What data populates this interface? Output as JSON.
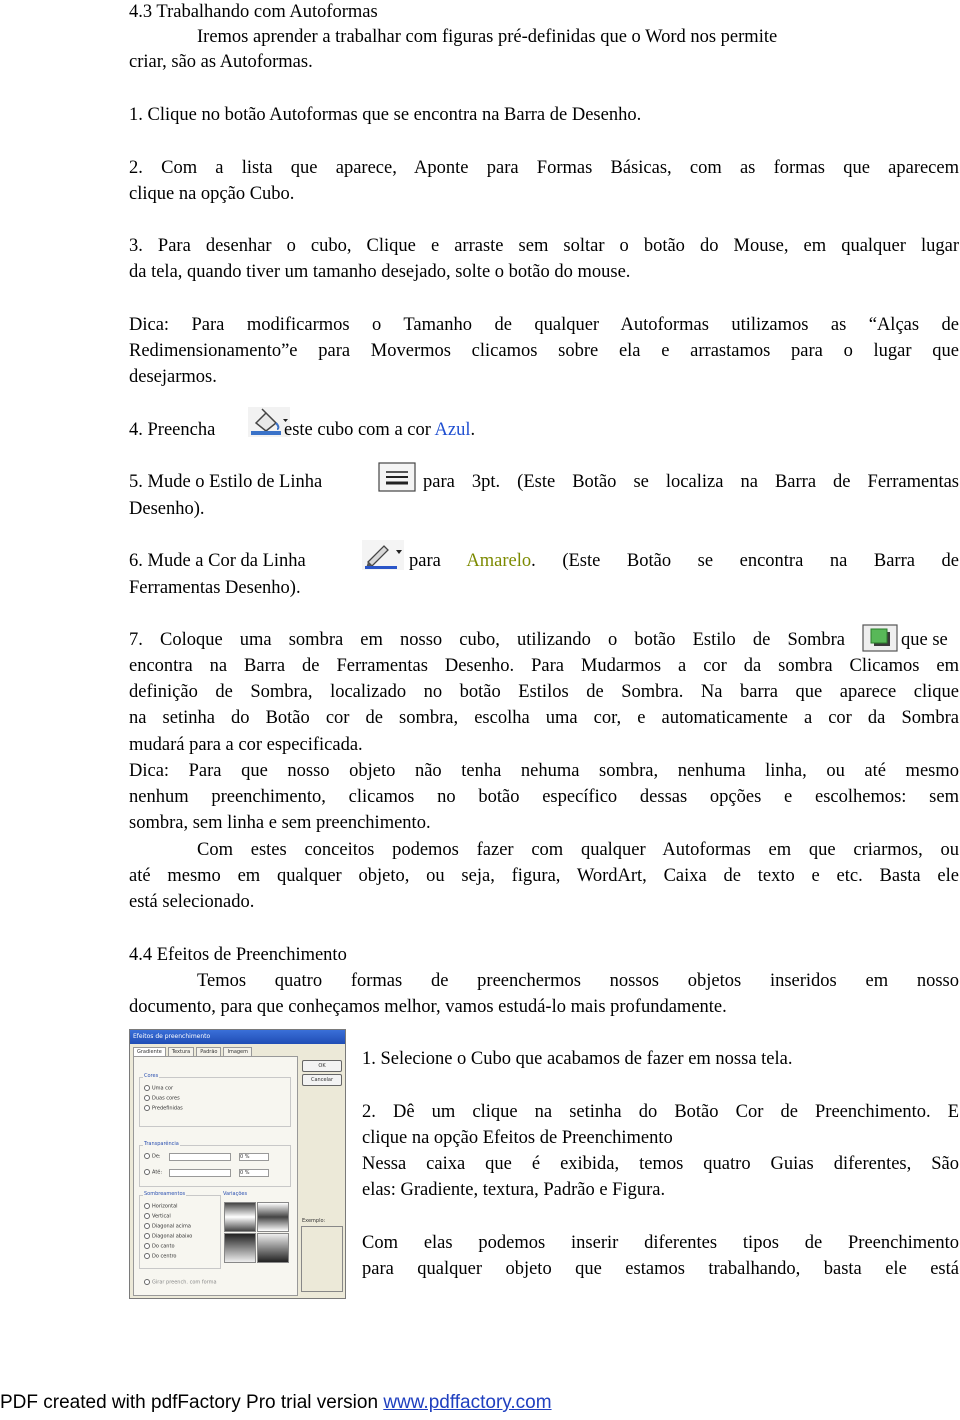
{
  "section1": {
    "heading": "4.3 Trabalhando com Autoformas",
    "intro_line1": "Iremos aprender a trabalhar com figuras pré-definidas que o Word nos permite",
    "intro_line2": "criar, são as Autoformas.",
    "step1": "1. Clique no botão Autoformas que se encontra na Barra de Desenho.",
    "step2_line1": "2. Com a lista que aparece, Aponte para Formas Básicas, com as formas que aparecem",
    "step2_line2": "clique na opção Cubo.",
    "step3_line1": "3. Para desenhar o cubo, Clique e arraste sem soltar o botão do Mouse, em qualquer lugar",
    "step3_line2": "da tela, quando tiver um tamanho desejado, solte o botão do mouse.",
    "tip_line1": "Dica: Para modificarmos o Tamanho de qualquer Autoformas utilizamos as “Alças de",
    "tip_line2": "Redimensionamento”e para Movermos clicamos sobre ela e arrastamos para o lugar que",
    "tip_line3": "desejarmos.",
    "step4_a": "4. Preencha",
    "step4_b": "este cubo com a cor",
    "step4_color": "Azul",
    "step4_end": ".",
    "step5_a": "5. Mude o Estilo de Linha",
    "step5_b": "para 3pt.  (Este Botão se localiza na Barra de Ferramentas",
    "step5_line2": "Desenho).",
    "step6_a": "6. Mude a Cor da Linha",
    "step6_b": "para",
    "step6_color": "Amarelo",
    "step6_c": ". (Este Botão se encontra na Barra de",
    "step6_line2": "Ferramentas Desenho).",
    "step7_line1_a": "7. Coloque uma sombra em nosso cubo, utilizando o botão Estilo de Sombra",
    "step7_line1_b": "que se",
    "step7_line2": "encontra na Barra de Ferramentas Desenho. Para Mudarmos a cor da sombra Clicamos em",
    "step7_line3": "definição de Sombra, localizado no botão Estilos de Sombra. Na barra que aparece clique",
    "step7_line4": "na setinha do Botão cor de sombra, escolha uma cor, e automaticamente a cor da Sombra",
    "step7_line5": "mudará para a cor especificada.",
    "tip2_line1": "Dica: Para que nosso objeto não tenha nehuma sombra, nenhuma linha, ou até mesmo",
    "tip2_line2": "nenhum preenchimento, clicamos no botão específico dessas opções e escolhemos: sem",
    "tip2_line3": "sombra, sem linha e sem preenchimento.",
    "concl_line1": "Com estes conceitos podemos fazer com qualquer Autoformas em que criarmos, ou",
    "concl_line2": "até mesmo em qualquer objeto, ou seja, figura, WordArt, Caixa de texto e etc. Basta ele",
    "concl_line3": "está selecionado."
  },
  "section2": {
    "heading": "4.4 Efeitos de Preenchimento",
    "intro_line1": "Temos quatro formas de preenchermos nossos objetos inseridos em nosso",
    "intro_line2": "documento, para que conheçamos melhor, vamos estudá-lo mais profundamente.",
    "step1": "1. Selecione o Cubo que acabamos de fazer em nossa tela.",
    "step2_line1": "2. Dê um clique na setinha do Botão Cor de Preenchimento. E",
    "step2_line2": "clique na opção Efeitos de Preenchimento",
    "desc_line1": "Nessa caixa que é exibida, temos quatro Guias diferentes, São",
    "desc_line2": "elas: Gradiente, textura, Padrão e Figura.",
    "final_line1": "Com elas podemos inserir diferentes tipos de Preenchimento",
    "final_line2": "para qualquer objeto que estamos trabalhando, basta ele está"
  },
  "dialog": {
    "title": "Efeitos de preenchimento",
    "tabs": [
      "Gradiente",
      "Textura",
      "Padrão",
      "Imagem"
    ],
    "ok": "OK",
    "cancel": "Cancelar",
    "cores_label": "Cores",
    "cores_options": [
      "Uma cor",
      "Duas cores",
      "Predefinidas"
    ],
    "transparency_label": "Transparência",
    "de_label": "De:",
    "ate_label": "Até:",
    "pct_de": "0 %",
    "pct_ate": "0 %",
    "shading_label": "Sombreamentos",
    "shading_options": [
      "Horizontal",
      "Vertical",
      "Diagonal acima",
      "Diagonal abaixo",
      "Do canto",
      "Do centro"
    ],
    "variations_label": "Variações",
    "sample_label": "Exemplo:",
    "rotate_label": "Girar preench. com forma"
  },
  "icons": [
    "paint-bucket-icon",
    "line-style-icon",
    "line-color-icon",
    "shadow-style-icon"
  ],
  "colors": {
    "blue_text": "#1f4fd1",
    "olive_text": "#7c8a00",
    "link": "#1f3fbf"
  },
  "footer": {
    "text": "PDF created with pdfFactory Pro trial version ",
    "link": "www.pdffactory.com"
  }
}
